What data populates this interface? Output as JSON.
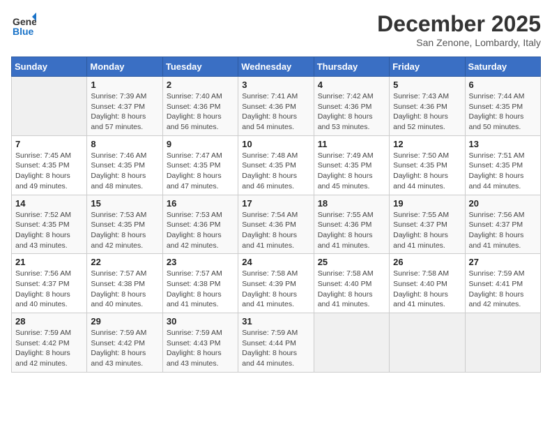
{
  "header": {
    "logo_line1": "General",
    "logo_line2": "Blue",
    "month": "December 2025",
    "location": "San Zenone, Lombardy, Italy"
  },
  "days_of_week": [
    "Sunday",
    "Monday",
    "Tuesday",
    "Wednesday",
    "Thursday",
    "Friday",
    "Saturday"
  ],
  "weeks": [
    [
      {
        "day": "",
        "info": ""
      },
      {
        "day": "1",
        "info": "Sunrise: 7:39 AM\nSunset: 4:37 PM\nDaylight: 8 hours\nand 57 minutes."
      },
      {
        "day": "2",
        "info": "Sunrise: 7:40 AM\nSunset: 4:36 PM\nDaylight: 8 hours\nand 56 minutes."
      },
      {
        "day": "3",
        "info": "Sunrise: 7:41 AM\nSunset: 4:36 PM\nDaylight: 8 hours\nand 54 minutes."
      },
      {
        "day": "4",
        "info": "Sunrise: 7:42 AM\nSunset: 4:36 PM\nDaylight: 8 hours\nand 53 minutes."
      },
      {
        "day": "5",
        "info": "Sunrise: 7:43 AM\nSunset: 4:36 PM\nDaylight: 8 hours\nand 52 minutes."
      },
      {
        "day": "6",
        "info": "Sunrise: 7:44 AM\nSunset: 4:35 PM\nDaylight: 8 hours\nand 50 minutes."
      }
    ],
    [
      {
        "day": "7",
        "info": "Sunrise: 7:45 AM\nSunset: 4:35 PM\nDaylight: 8 hours\nand 49 minutes."
      },
      {
        "day": "8",
        "info": "Sunrise: 7:46 AM\nSunset: 4:35 PM\nDaylight: 8 hours\nand 48 minutes."
      },
      {
        "day": "9",
        "info": "Sunrise: 7:47 AM\nSunset: 4:35 PM\nDaylight: 8 hours\nand 47 minutes."
      },
      {
        "day": "10",
        "info": "Sunrise: 7:48 AM\nSunset: 4:35 PM\nDaylight: 8 hours\nand 46 minutes."
      },
      {
        "day": "11",
        "info": "Sunrise: 7:49 AM\nSunset: 4:35 PM\nDaylight: 8 hours\nand 45 minutes."
      },
      {
        "day": "12",
        "info": "Sunrise: 7:50 AM\nSunset: 4:35 PM\nDaylight: 8 hours\nand 44 minutes."
      },
      {
        "day": "13",
        "info": "Sunrise: 7:51 AM\nSunset: 4:35 PM\nDaylight: 8 hours\nand 44 minutes."
      }
    ],
    [
      {
        "day": "14",
        "info": "Sunrise: 7:52 AM\nSunset: 4:35 PM\nDaylight: 8 hours\nand 43 minutes."
      },
      {
        "day": "15",
        "info": "Sunrise: 7:53 AM\nSunset: 4:35 PM\nDaylight: 8 hours\nand 42 minutes."
      },
      {
        "day": "16",
        "info": "Sunrise: 7:53 AM\nSunset: 4:36 PM\nDaylight: 8 hours\nand 42 minutes."
      },
      {
        "day": "17",
        "info": "Sunrise: 7:54 AM\nSunset: 4:36 PM\nDaylight: 8 hours\nand 41 minutes."
      },
      {
        "day": "18",
        "info": "Sunrise: 7:55 AM\nSunset: 4:36 PM\nDaylight: 8 hours\nand 41 minutes."
      },
      {
        "day": "19",
        "info": "Sunrise: 7:55 AM\nSunset: 4:37 PM\nDaylight: 8 hours\nand 41 minutes."
      },
      {
        "day": "20",
        "info": "Sunrise: 7:56 AM\nSunset: 4:37 PM\nDaylight: 8 hours\nand 41 minutes."
      }
    ],
    [
      {
        "day": "21",
        "info": "Sunrise: 7:56 AM\nSunset: 4:37 PM\nDaylight: 8 hours\nand 40 minutes."
      },
      {
        "day": "22",
        "info": "Sunrise: 7:57 AM\nSunset: 4:38 PM\nDaylight: 8 hours\nand 40 minutes."
      },
      {
        "day": "23",
        "info": "Sunrise: 7:57 AM\nSunset: 4:38 PM\nDaylight: 8 hours\nand 41 minutes."
      },
      {
        "day": "24",
        "info": "Sunrise: 7:58 AM\nSunset: 4:39 PM\nDaylight: 8 hours\nand 41 minutes."
      },
      {
        "day": "25",
        "info": "Sunrise: 7:58 AM\nSunset: 4:40 PM\nDaylight: 8 hours\nand 41 minutes."
      },
      {
        "day": "26",
        "info": "Sunrise: 7:58 AM\nSunset: 4:40 PM\nDaylight: 8 hours\nand 41 minutes."
      },
      {
        "day": "27",
        "info": "Sunrise: 7:59 AM\nSunset: 4:41 PM\nDaylight: 8 hours\nand 42 minutes."
      }
    ],
    [
      {
        "day": "28",
        "info": "Sunrise: 7:59 AM\nSunset: 4:42 PM\nDaylight: 8 hours\nand 42 minutes."
      },
      {
        "day": "29",
        "info": "Sunrise: 7:59 AM\nSunset: 4:42 PM\nDaylight: 8 hours\nand 43 minutes."
      },
      {
        "day": "30",
        "info": "Sunrise: 7:59 AM\nSunset: 4:43 PM\nDaylight: 8 hours\nand 43 minutes."
      },
      {
        "day": "31",
        "info": "Sunrise: 7:59 AM\nSunset: 4:44 PM\nDaylight: 8 hours\nand 44 minutes."
      },
      {
        "day": "",
        "info": ""
      },
      {
        "day": "",
        "info": ""
      },
      {
        "day": "",
        "info": ""
      }
    ]
  ]
}
